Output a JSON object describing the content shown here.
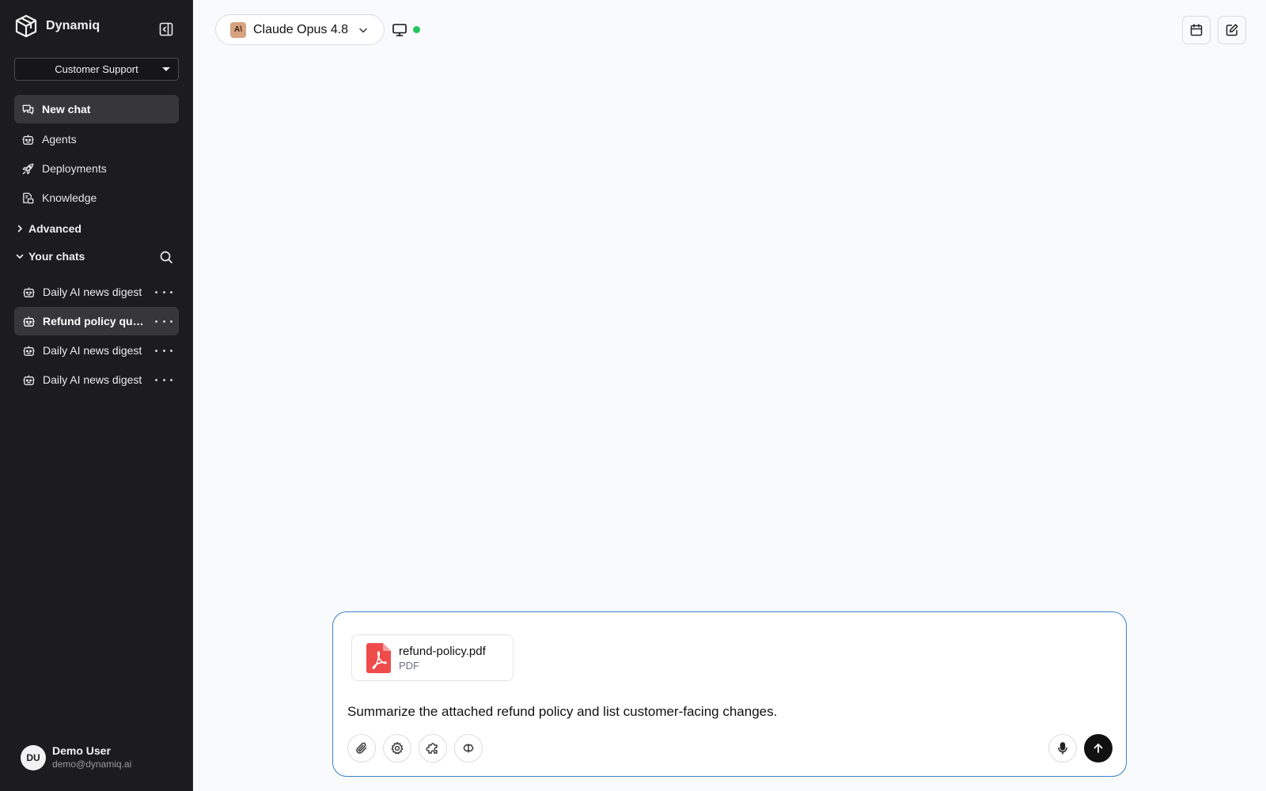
{
  "brand": {
    "name": "Dynamiq",
    "logo_icon": "dynamiq-logo-icon"
  },
  "workspace": {
    "selected": "Customer Support"
  },
  "nav": [
    {
      "label": "New chat",
      "icon": "chat-icon",
      "active": true
    },
    {
      "label": "Agents",
      "icon": "robot-icon"
    },
    {
      "label": "Deployments",
      "icon": "rocket-icon"
    },
    {
      "label": "Knowledge",
      "icon": "knowledge-icon"
    }
  ],
  "sections": {
    "advanced": "Advanced",
    "your_chats": "Your chats"
  },
  "chats": [
    {
      "label": "Daily AI news digest"
    },
    {
      "label": "Refund policy question",
      "active": true
    },
    {
      "label": "Daily AI news digest"
    },
    {
      "label": "Daily AI news digest"
    }
  ],
  "user": {
    "initials": "DU",
    "name": "Demo User",
    "email": "demo@dynamiq.ai"
  },
  "topbar": {
    "model_logo_text": "A\\",
    "model_name": "Claude Opus 4.8",
    "status_color": "#22c55e"
  },
  "composer": {
    "attachment": {
      "name": "refund-policy.pdf",
      "type": "PDF"
    },
    "prompt": "Summarize the attached refund policy and list customer-facing changes.",
    "accent_color": "#3b82c4"
  }
}
